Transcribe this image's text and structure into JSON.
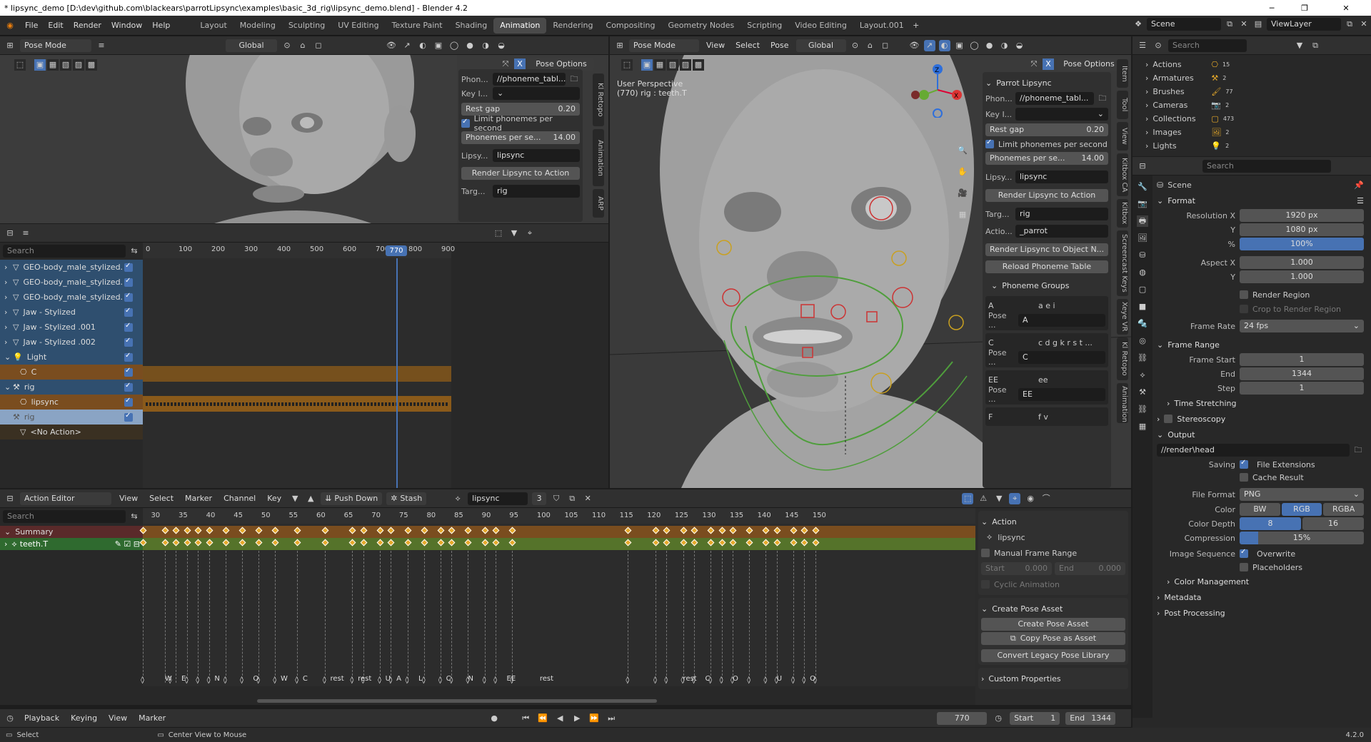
{
  "window": {
    "title": "* lipsync_demo [D:\\dev\\github.com\\blackears\\parrotLipsync\\examples\\basic_3d_rig\\lipsync_demo.blend] - Blender 4.2",
    "minimize": "─",
    "maximize": "❐",
    "close": "✕"
  },
  "menus": [
    "File",
    "Edit",
    "Render",
    "Window",
    "Help"
  ],
  "workspaces": [
    "Layout",
    "Modeling",
    "Sculpting",
    "UV Editing",
    "Texture Paint",
    "Shading",
    "Animation",
    "Rendering",
    "Compositing",
    "Geometry Nodes",
    "Scripting",
    "Video Editing",
    "Layout.001"
  ],
  "active_workspace": "Animation",
  "scene": {
    "label": "Scene",
    "view_layer": "ViewLayer"
  },
  "vp_left": {
    "mode": "Pose Mode",
    "orientation": "Global",
    "pose_options": "Pose Options",
    "panel": {
      "phon_label": "Phon...",
      "phon_value": "//phoneme_tabl...",
      "key_label": "Key I...",
      "rest_gap_label": "Rest gap",
      "rest_gap": "0.20",
      "limit_label": "Limit phonemes per second",
      "pps_label": "Phonemes per se...",
      "pps": "14.00",
      "lipsy_label": "Lipsy...",
      "lipsy_value": "lipsync",
      "render_btn": "Render Lipsync to Action",
      "targ_label": "Targ...",
      "targ_value": "rig"
    },
    "tabs": [
      "Kl Retopo",
      "Animation",
      "ARP"
    ]
  },
  "vp_right": {
    "mode": "Pose Mode",
    "menus": [
      "View",
      "Select",
      "Pose"
    ],
    "orientation": "Global",
    "pose_options": "Pose Options",
    "overlay_line1": "User Perspective",
    "overlay_line2": "(770) rig : teeth.T",
    "panel": {
      "title": "Parrot Lipsync",
      "phon_label": "Phon...",
      "phon_value": "//phoneme_tabl...",
      "key_label": "Key I...",
      "rest_gap_label": "Rest gap",
      "rest_gap": "0.20",
      "limit_label": "Limit phonemes per second",
      "pps_label": "Phonemes per se...",
      "pps": "14.00",
      "lipsy_label": "Lipsy...",
      "lipsy_value": "lipsync",
      "render_btn": "Render Lipsync to Action",
      "targ_label": "Targ...",
      "targ_value": "rig",
      "action_label": "Actio...",
      "action_value": "_parrot",
      "render_obj_btn": "Render Lipsync to Object N...",
      "reload_btn": "Reload Phoneme Table",
      "groups_title": "Phoneme Groups",
      "groups": [
        {
          "name": "A",
          "phonemes": "a e i",
          "pose_label": "Pose ...",
          "pose": "A"
        },
        {
          "name": "C",
          "phonemes": "c d g k r s t ...",
          "pose_label": "Pose ...",
          "pose": "C"
        },
        {
          "name": "EE",
          "phonemes": "ee",
          "pose_label": "Pose ...",
          "pose": "EE"
        },
        {
          "name": "F",
          "phonemes": "f v"
        }
      ]
    },
    "tabs": [
      "Item",
      "Tool",
      "View",
      "Kitbox CA",
      "Kitbox",
      "Screencast Keys",
      "Xeye VR",
      "Kl Retopo",
      "Animation"
    ]
  },
  "nla": {
    "search": "Search",
    "current_frame": "770",
    "ruler": [
      "0",
      "100",
      "200",
      "300",
      "400",
      "500",
      "600",
      "700",
      "800",
      "900"
    ],
    "tracks": [
      {
        "name": "GEO-body_male_stylized.",
        "type": "obj"
      },
      {
        "name": "GEO-body_male_stylized.",
        "type": "obj"
      },
      {
        "name": "GEO-body_male_stylized.",
        "type": "obj"
      },
      {
        "name": "Jaw - Stylized",
        "type": "obj"
      },
      {
        "name": "Jaw - Stylized .001",
        "type": "obj"
      },
      {
        "name": "Jaw - Stylized .002",
        "type": "obj"
      },
      {
        "name": "Light",
        "type": "obj"
      },
      {
        "name": "C",
        "type": "action"
      },
      {
        "name": "rig",
        "type": "obj"
      },
      {
        "name": "lipsync",
        "type": "action"
      },
      {
        "name": "rig",
        "type": "sel"
      },
      {
        "name": "<No Action>",
        "type": "noaction"
      }
    ]
  },
  "action_editor": {
    "mode": "Action Editor",
    "menus": [
      "View",
      "Select",
      "Marker",
      "Channel",
      "Key"
    ],
    "push_down": "Push Down",
    "stash": "Stash",
    "action": "lipsync",
    "users": "3",
    "search": "Search",
    "ruler": [
      "30",
      "35",
      "40",
      "45",
      "50",
      "55",
      "60",
      "65",
      "70",
      "75",
      "80",
      "85",
      "90",
      "95",
      "100",
      "105",
      "110",
      "115",
      "120",
      "125",
      "130",
      "135",
      "140",
      "145",
      "150"
    ],
    "channels": [
      {
        "name": "Summary"
      },
      {
        "name": "teeth.T"
      }
    ],
    "markers": [
      "W",
      "E",
      "N",
      "O",
      "W",
      "C",
      "rest",
      "rest",
      "U",
      "A",
      "L",
      "C",
      "N",
      "EE",
      "rest",
      "rest",
      "C",
      "O",
      "U",
      "O",
      "re",
      "O"
    ]
  },
  "action_side": {
    "action_title": "Action",
    "action_name": "lipsync",
    "manual_range": "Manual Frame Range",
    "start_label": "Start",
    "start": "0.000",
    "end_label": "End",
    "end": "0.000",
    "cyclic": "Cyclic Animation",
    "pose_asset_title": "Create Pose Asset",
    "create_btn": "Create Pose Asset",
    "copy_btn": "Copy Pose as Asset",
    "convert_btn": "Convert Legacy Pose Library",
    "custom_props": "Custom Properties"
  },
  "timeline": {
    "menus": [
      "Playback",
      "Keying",
      "View",
      "Marker"
    ],
    "frame": "770",
    "start_label": "Start",
    "start": "1",
    "end_label": "End",
    "end": "1344"
  },
  "statusbar": {
    "select": "Select",
    "center": "Center View to Mouse",
    "version": "4.2.0"
  },
  "outliner": {
    "search": "Search",
    "items": [
      {
        "name": "Actions",
        "count": "15"
      },
      {
        "name": "Armatures",
        "count": "2"
      },
      {
        "name": "Brushes",
        "count": "77"
      },
      {
        "name": "Cameras",
        "count": "2"
      },
      {
        "name": "Collections",
        "count": "473"
      },
      {
        "name": "Images",
        "count": "2"
      },
      {
        "name": "Lights",
        "count": "2"
      }
    ]
  },
  "props": {
    "search": "Search",
    "scene": "Scene",
    "format_title": "Format",
    "res_x_label": "Resolution X",
    "res_x": "1920 px",
    "res_y_label": "Y",
    "res_y": "1080 px",
    "pct_label": "%",
    "pct": "100%",
    "aspect_x_label": "Aspect X",
    "aspect_x": "1.000",
    "aspect_y_label": "Y",
    "aspect_y": "1.000",
    "render_region": "Render Region",
    "crop": "Crop to Render Region",
    "fps_label": "Frame Rate",
    "fps": "24 fps",
    "range_title": "Frame Range",
    "fstart_label": "Frame Start",
    "fstart": "1",
    "fend_label": "End",
    "fend": "1344",
    "fstep_label": "Step",
    "fstep": "1",
    "time_stretch": "Time Stretching",
    "stereo": "Stereoscopy",
    "output_title": "Output",
    "output_path": "//render\\head",
    "saving_label": "Saving",
    "file_ext": "File Extensions",
    "cache": "Cache Result",
    "format_label": "File Format",
    "format": "PNG",
    "color_label": "Color",
    "bw": "BW",
    "rgb": "RGB",
    "rgba": "RGBA",
    "depth_label": "Color Depth",
    "d8": "8",
    "d16": "16",
    "comp_label": "Compression",
    "comp": "15%",
    "seq_label": "Image Sequence",
    "overwrite": "Overwrite",
    "placeholders": "Placeholders",
    "color_mgmt": "Color Management",
    "metadata": "Metadata",
    "post": "Post Processing"
  }
}
